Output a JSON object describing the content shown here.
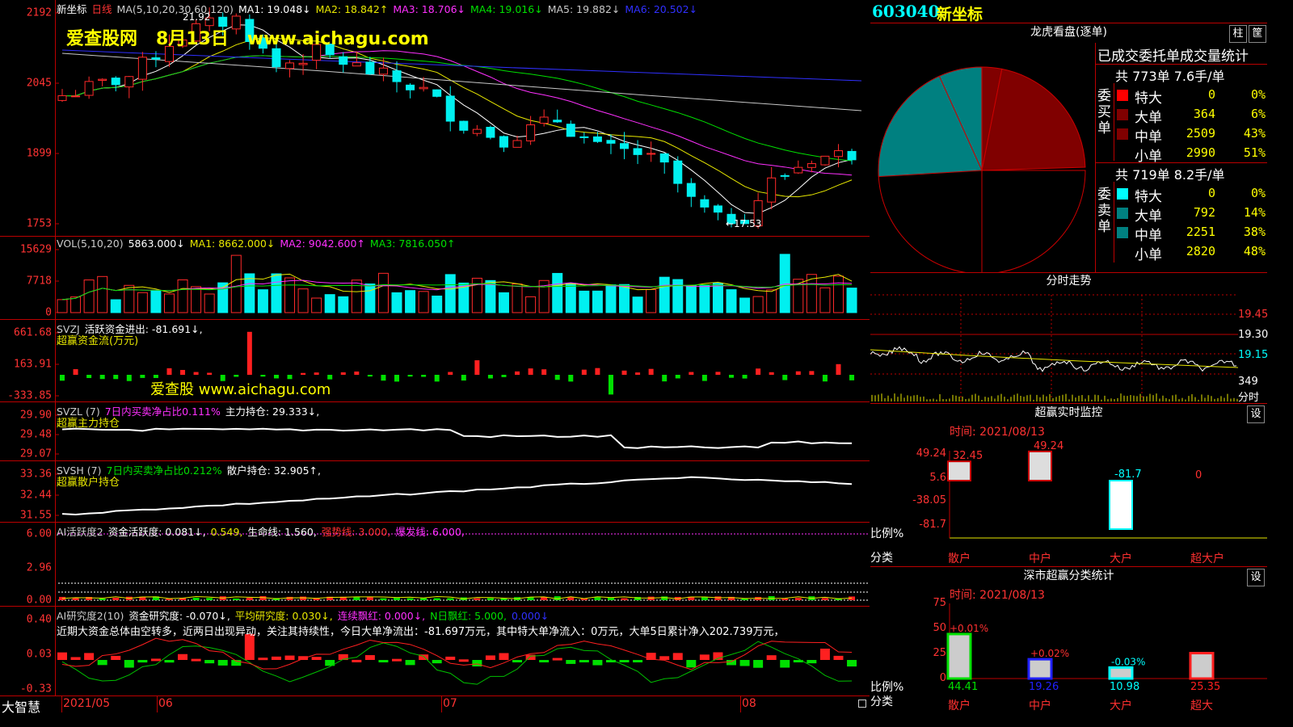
{
  "stock": {
    "code": "603040",
    "name": "新坐标",
    "period": "日线"
  },
  "watermark": {
    "site": "爱查股网",
    "date": "8月13日",
    "url": "www.aichagu.com",
    "mid": "爱查股 www.aichagu.com"
  },
  "colors": {
    "up": "#ff2a2a",
    "down": "#00f0f0",
    "ma1": "#ffffff",
    "ma2": "#e8e800",
    "ma3": "#ff30ff",
    "ma4": "#00e000",
    "ma5": "#c8c8c8",
    "ma6": "#3030ff"
  },
  "main": {
    "ma_label": "MA(5,10,20,30,60,120)",
    "ma_values": [
      {
        "label": "MA1: 19.048↓",
        "color": "#ffffff"
      },
      {
        "label": "MA2: 18.842↑",
        "color": "#e8e800"
      },
      {
        "label": "MA3: 18.706↓",
        "color": "#ff30ff"
      },
      {
        "label": "MA4: 19.016↓",
        "color": "#00e000"
      },
      {
        "label": "MA5: 19.882↓",
        "color": "#c8c8c8"
      },
      {
        "label": "MA6: 20.502↓",
        "color": "#3030ff"
      }
    ],
    "y_ticks": [
      "2192",
      "2045",
      "1899",
      "1753"
    ],
    "high_label": "21.92",
    "low_label": "←17.53"
  },
  "vol": {
    "label": "VOL(5,10,20)",
    "value": "5863.000↓",
    "ma1": "MA1: 8662.000↓",
    "ma2": "MA2: 9042.600↑",
    "ma3": "MA3: 7816.050↑",
    "y_ticks": [
      "15629",
      "7718",
      "0"
    ]
  },
  "svzj": {
    "label": "SVZJ",
    "desc": "活跃资金进出: -81.691↓,",
    "sub": "超赢资金流(万元)",
    "y_ticks": [
      "661.68",
      "163.91",
      "-333.85"
    ]
  },
  "svzl": {
    "label": "SVZL (7)",
    "desc1": "7日内买卖净占比0.111%",
    "desc2": "主力持仓: 29.333↓,",
    "sub": "超赢主力持仓",
    "y_ticks": [
      "29.90",
      "29.48",
      "29.07"
    ]
  },
  "svsh": {
    "label": "SVSH (7)",
    "desc1": "7日内买卖净占比0.212%",
    "desc2": "散户持仓: 32.905↑,",
    "sub": "超赢散户持仓",
    "y_ticks": [
      "33.36",
      "32.44",
      "31.55"
    ]
  },
  "ai1": {
    "label": "AI活跃度2",
    "a": "资金活跃度: 0.081↓,",
    "b": "0.549,",
    "c": "生命线: 1.560,",
    "d": "强势线: 3.000,",
    "e": "爆发线: 6.000,",
    "y_ticks": [
      "6.00",
      "2.96",
      "0.00"
    ]
  },
  "ai2": {
    "label": "AI研究度2(10)",
    "a": "资金研究度: -0.070↓,",
    "b": "平均研究度: 0.030↓,",
    "c": "连续飘红: 0.000↓,",
    "d": "N日飘红: 5.000,",
    "e": "0.000↓",
    "text": "近期大资金总体由空转多，近两日出现异动，关注其持续性，今日大单净流出：-81.697万元，其中特大单净流入：0万元，大单5日累计净入202.739万元，",
    "y_ticks": [
      "0.40",
      "0.03",
      "-0.33"
    ]
  },
  "xaxis": {
    "brand": "大智慧",
    "labels": [
      "2021/05",
      "06",
      "07",
      "08"
    ]
  },
  "dragon": {
    "title": "龙虎看盘(逐单)",
    "btn1": "柱",
    "btn2": "筐",
    "stat_title": "已成交委托单成交量统计",
    "buy": {
      "total": "共 773单 7.6手/单",
      "side": "委买单",
      "rows": [
        {
          "name": "特大",
          "count": "0",
          "pct": "0%",
          "color": "#ff0000"
        },
        {
          "name": "大单",
          "count": "364",
          "pct": "6%",
          "color": "#800000"
        },
        {
          "name": "中单",
          "count": "2509",
          "pct": "43%",
          "color": "#800000"
        },
        {
          "name": "小单",
          "count": "2990",
          "pct": "51%",
          "color": "#000000"
        }
      ]
    },
    "sell": {
      "total": "共 719单 8.2手/单",
      "side": "委卖单",
      "rows": [
        {
          "name": "特大",
          "count": "0",
          "pct": "0%",
          "color": "#00ffff"
        },
        {
          "name": "大单",
          "count": "792",
          "pct": "14%",
          "color": "#008080"
        },
        {
          "name": "中单",
          "count": "2251",
          "pct": "38%",
          "color": "#008080"
        },
        {
          "name": "小单",
          "count": "2820",
          "pct": "48%",
          "color": "#000000"
        }
      ]
    }
  },
  "intraday": {
    "title": "分时走势",
    "y_ticks": [
      "19.45",
      "19.30",
      "19.15"
    ],
    "vol_label": "349",
    "vol_sub": "分时"
  },
  "monitor": {
    "title": "超赢实时监控",
    "btn": "设",
    "date": "时间: 2021/08/13",
    "y_ticks": [
      "49.24",
      "5.6",
      "-38.05",
      "-81.7"
    ],
    "ratio": "比例%",
    "cat": "分类",
    "bars": [
      {
        "name": "散户",
        "value": 32.45,
        "label": "32.45"
      },
      {
        "name": "中户",
        "value": 49.24,
        "label": "49.24"
      },
      {
        "name": "大户",
        "value": -81.7,
        "label": "-81.7"
      },
      {
        "name": "超大户",
        "value": 0,
        "label": "0"
      }
    ]
  },
  "szstat": {
    "title": "深市超赢分类统计",
    "btn": "设",
    "date": "时间: 2021/08/13",
    "y_ticks": [
      "75",
      "50",
      "25",
      "0"
    ],
    "ratio": "比例%",
    "cat": "分类",
    "bars": [
      {
        "name": "散户",
        "value": 44.41,
        "label": "44.41",
        "chg": "+0.01%"
      },
      {
        "name": "中户",
        "value": 19.26,
        "label": "19.26",
        "chg": "+0.02%"
      },
      {
        "name": "大户",
        "value": 10.98,
        "label": "10.98",
        "chg": "-0.03%"
      },
      {
        "name": "超大",
        "value": 25.35,
        "label": "25.35",
        "chg": ""
      }
    ]
  },
  "chart_data": {
    "type": "bar",
    "categories": [
      "散户",
      "中户",
      "大户",
      "超大户"
    ],
    "series": [
      {
        "name": "比例%",
        "values": [
          32.45,
          49.24,
          -81.7,
          0
        ]
      }
    ]
  }
}
